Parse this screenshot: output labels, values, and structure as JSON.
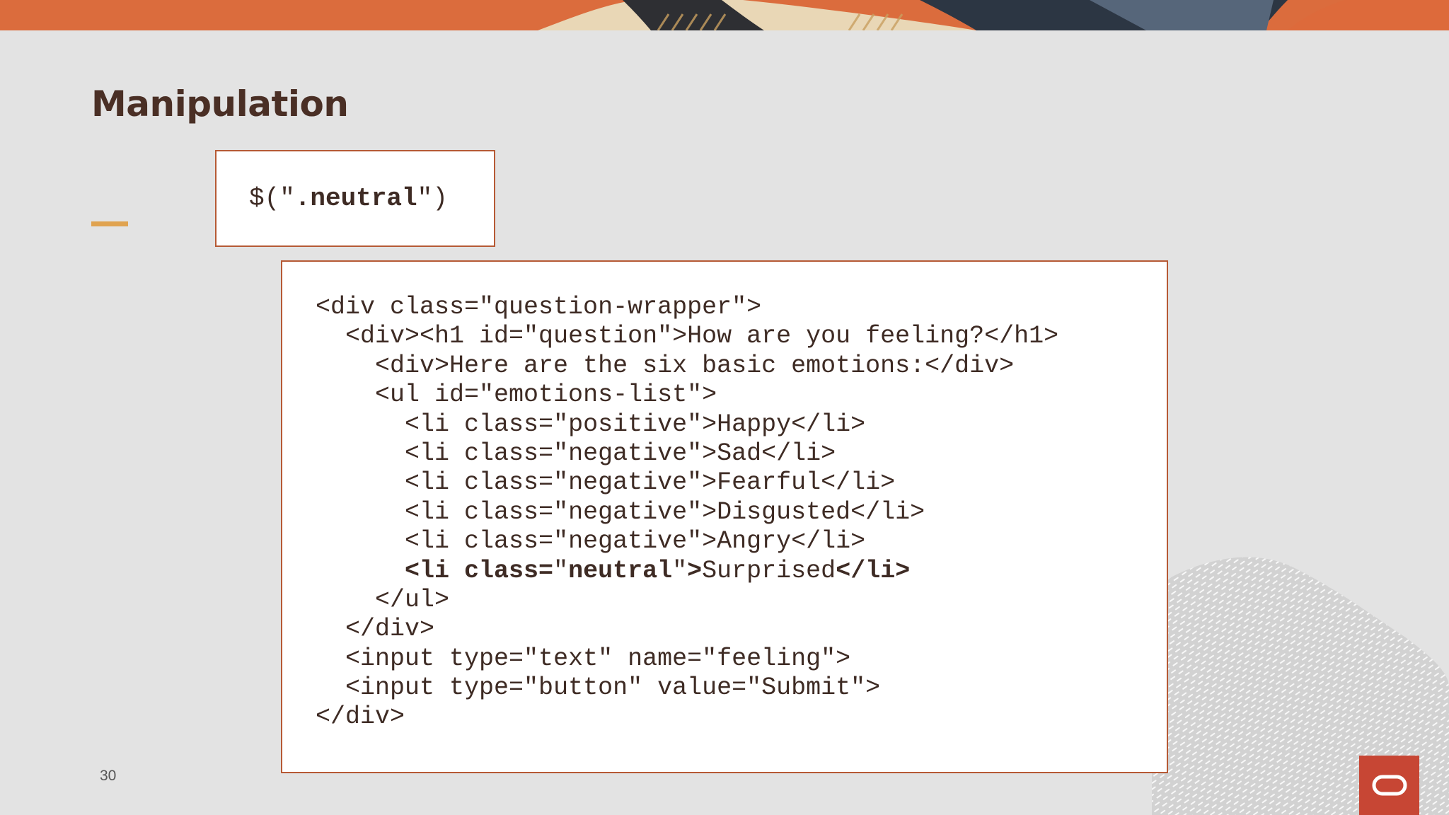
{
  "slide": {
    "title": "Manipulation",
    "page_number": "30"
  },
  "selector": {
    "prefix": "$(\"",
    "selector": ".neutral",
    "suffix": "\")"
  },
  "code": {
    "lines": [
      {
        "indent": "",
        "text": "<div class=\"question-wrapper\">"
      },
      {
        "indent": "  ",
        "text": "<div><h1 id=\"question\">How are you feeling?</h1>"
      },
      {
        "indent": "    ",
        "text": "<div>Here are the six basic emotions:</div>"
      },
      {
        "indent": "    ",
        "text": "<ul id=\"emotions-list\">"
      },
      {
        "indent": "      ",
        "text": "<li class=\"positive\">Happy</li>"
      },
      {
        "indent": "      ",
        "text": "<li class=\"negative\">Sad</li>"
      },
      {
        "indent": "      ",
        "text": "<li class=\"negative\">Fearful</li>"
      },
      {
        "indent": "      ",
        "text": "<li class=\"negative\">Disgusted</li>"
      },
      {
        "indent": "      ",
        "text": "<li class=\"negative\">Angry</li>"
      },
      {
        "indent": "      ",
        "highlighted": true,
        "parts": {
          "open": "<li class=",
          "q1": "\"",
          "cls": "neutral",
          "q2": "\"",
          "gt": ">",
          "content": "Surprised",
          "close": "</li>"
        }
      },
      {
        "indent": "    ",
        "text": "</ul>"
      },
      {
        "indent": "  ",
        "text": "</div>"
      },
      {
        "indent": "  ",
        "text": "<input type=\"text\" name=\"feeling\">"
      },
      {
        "indent": "  ",
        "text": "<input type=\"button\" value=\"Submit\">"
      },
      {
        "indent": "",
        "text": "</div>"
      }
    ]
  },
  "colors": {
    "background": "#e3e3e3",
    "title": "#4a2f25",
    "accent": "#e0a350",
    "box_border": "#b65a35",
    "logo": "#c74634"
  },
  "icons": {
    "logo": "oracle-logo-icon"
  }
}
